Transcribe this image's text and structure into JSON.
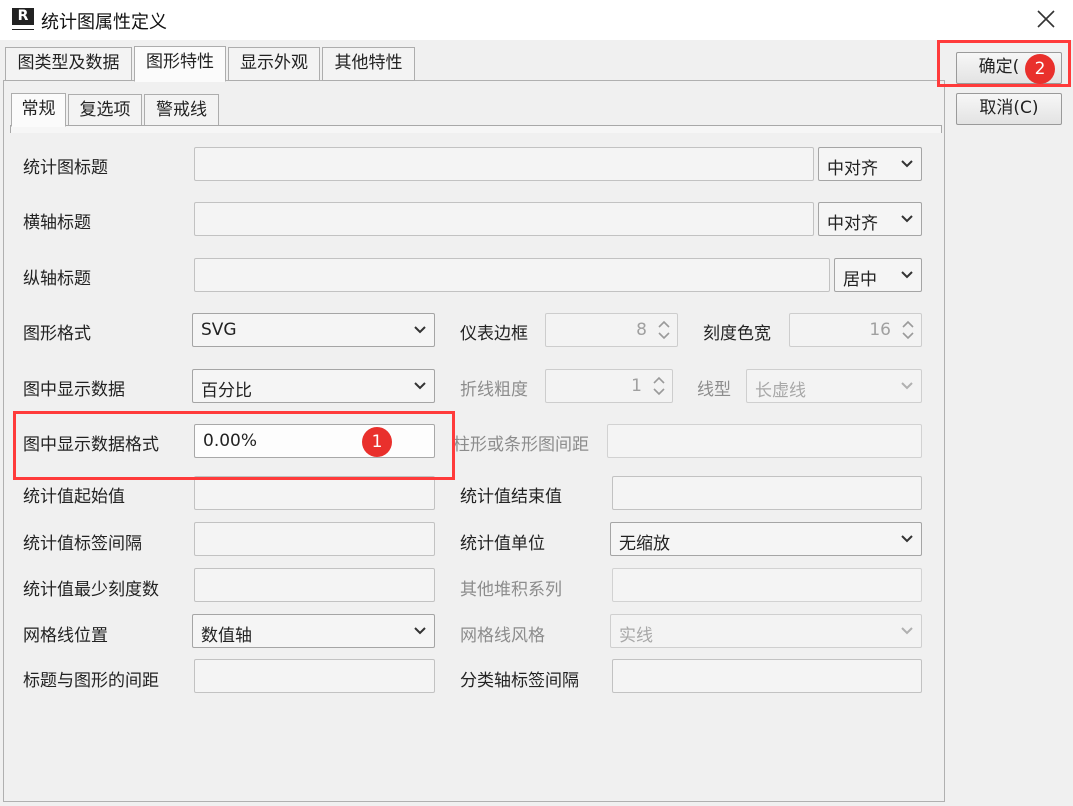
{
  "window": {
    "title": "统计图属性定义",
    "app_icon_letter": "R"
  },
  "tabs": [
    "图类型及数据",
    "图形特性",
    "显示外观",
    "其他特性"
  ],
  "subtabs": [
    "常规",
    "复选项",
    "警戒线"
  ],
  "buttons": {
    "ok": "确定(",
    "cancel": "取消(C)"
  },
  "form": {
    "chart_title_label": "统计图标题",
    "chart_title_align": "中对齐",
    "x_title_label": "横轴标题",
    "x_title_align": "中对齐",
    "y_title_label": "纵轴标题",
    "y_title_align": "居中",
    "graph_format_label": "图形格式",
    "graph_format_value": "SVG",
    "meter_border_label": "仪表边框",
    "meter_border_value": "8",
    "scale_width_label": "刻度色宽",
    "scale_width_value": "16",
    "display_data_label": "图中显示数据",
    "display_data_value": "百分比",
    "line_thickness_label": "折线粗度",
    "line_thickness_value": "1",
    "line_type_label": "线型",
    "line_type_value": "长虚线",
    "display_format_label": "图中显示数据格式",
    "display_format_value": "0.00%",
    "bar_spacing_label": "柱形或条形图间距",
    "stat_start_label": "统计值起始值",
    "stat_end_label": "统计值结束值",
    "stat_interval_label": "统计值标签间隔",
    "stat_unit_label": "统计值单位",
    "stat_unit_value": "无缩放",
    "stat_min_ticks_label": "统计值最少刻度数",
    "other_stack_label": "其他堆积系列",
    "grid_position_label": "网格线位置",
    "grid_position_value": "数值轴",
    "grid_style_label": "网格线风格",
    "grid_style_value": "实线",
    "title_spacing_label": "标题与图形的间距",
    "category_interval_label": "分类轴标签间隔"
  },
  "markers": {
    "one": "1",
    "two": "2"
  },
  "colors": {
    "highlight": "#ff3b3b",
    "marker": "#e9302c"
  }
}
